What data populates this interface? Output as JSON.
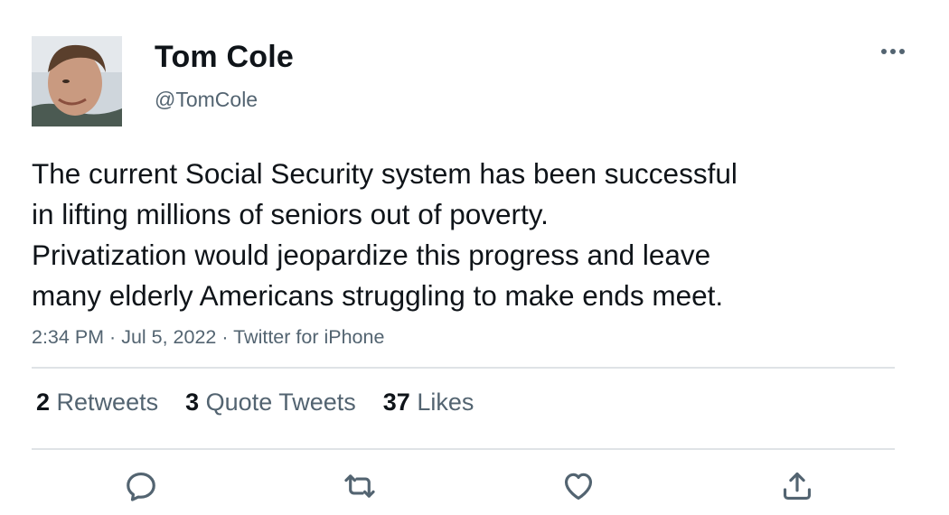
{
  "author": {
    "display_name": "Tom Cole",
    "handle": "@TomCole"
  },
  "tweet": {
    "lines": [
      "The current Social Security system has been successful",
      "in lifting millions of seniors out of poverty.",
      "Privatization would jeopardize this progress and leave",
      "many elderly Americans struggling to make ends meet."
    ]
  },
  "meta": {
    "time": "2:34 PM",
    "sep1": " · ",
    "date": "Jul 5, 2022",
    "sep2": " · ",
    "source": "Twitter for iPhone"
  },
  "stats": {
    "retweets": {
      "count": "2",
      "label": "Retweets"
    },
    "quotes": {
      "count": "3",
      "label": "Quote Tweets"
    },
    "likes": {
      "count": "37",
      "label": "Likes"
    }
  },
  "icons": {
    "more": "more-horizontal-icon",
    "reply": "reply-icon",
    "retweet": "retweet-icon",
    "like": "heart-icon",
    "share": "share-icon"
  },
  "colors": {
    "text": "#0f1419",
    "secondary": "#536471",
    "divider": "#dfe3e6"
  }
}
